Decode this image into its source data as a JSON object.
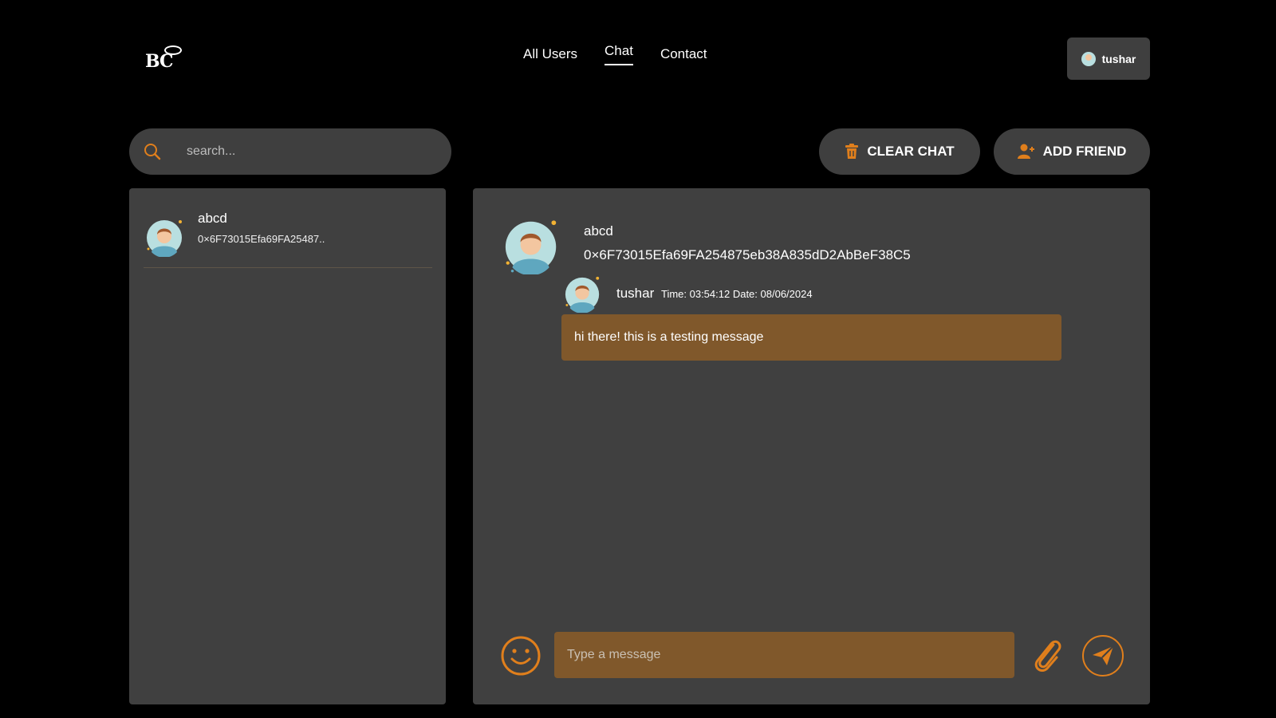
{
  "header": {
    "logo_text": "BC",
    "nav": [
      {
        "label": "All Users"
      },
      {
        "label": "Chat"
      },
      {
        "label": "Contact"
      }
    ],
    "user": {
      "name": "tushar"
    }
  },
  "search": {
    "placeholder": "search..."
  },
  "actions": {
    "clear_label": "CLEAR CHAT",
    "add_label": "ADD FRIEND"
  },
  "contacts": [
    {
      "name": "abcd",
      "address": "0×6F73015Efa69FA25487.."
    }
  ],
  "chat": {
    "friend_name": "abcd",
    "friend_address": "0×6F73015Efa69FA254875eb38A835dD2AbBeF38C5",
    "messages": [
      {
        "sender": "tushar",
        "time": "Time: 03:54:12 Date: 08/06/2024",
        "text": "hi there! this is a testing message"
      }
    ]
  },
  "composer": {
    "placeholder": "Type a message"
  },
  "colors": {
    "accent": "#e07f1c",
    "bubble": "#80582b",
    "panel": "#404040",
    "background": "#000000"
  }
}
